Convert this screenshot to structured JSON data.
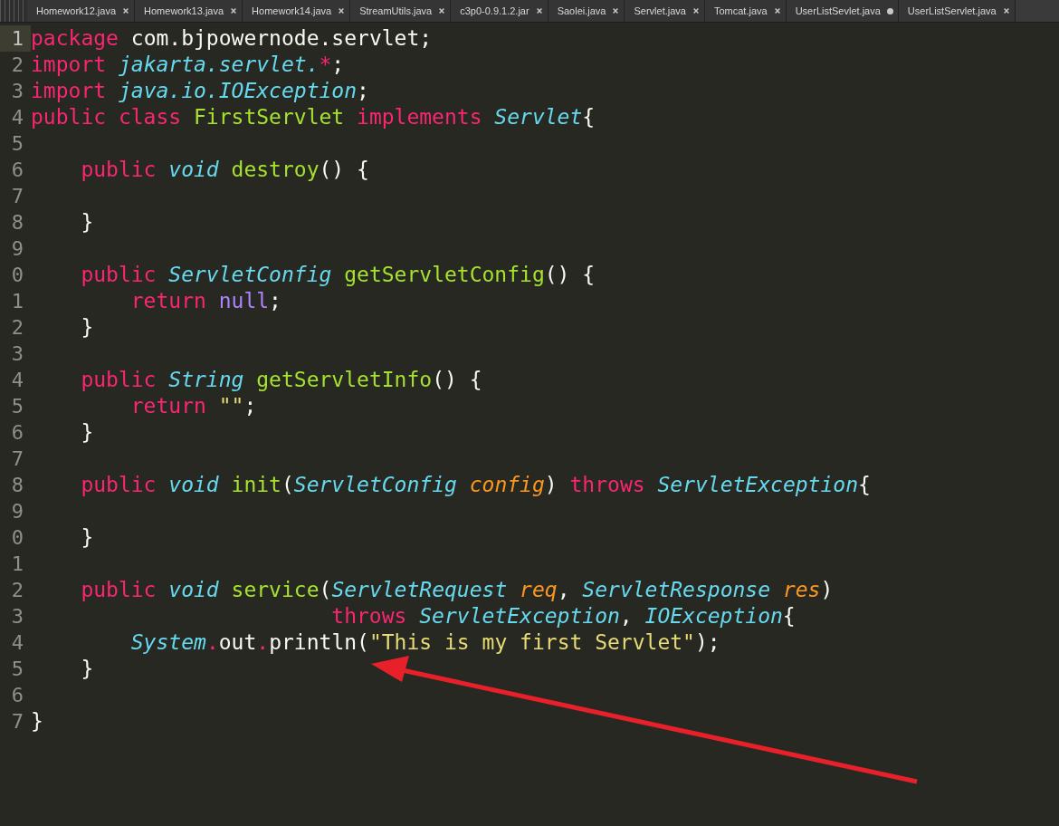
{
  "tabs": [
    {
      "label": "Homework12.java",
      "modified": false
    },
    {
      "label": "Homework13.java",
      "modified": false
    },
    {
      "label": "Homework14.java",
      "modified": false
    },
    {
      "label": "StreamUtils.java",
      "modified": false
    },
    {
      "label": "c3p0-0.9.1.2.jar",
      "modified": false
    },
    {
      "label": "Saolei.java",
      "modified": false
    },
    {
      "label": "Servlet.java",
      "modified": false
    },
    {
      "label": "Tomcat.java",
      "modified": false
    },
    {
      "label": "UserListSevlet.java",
      "modified": true
    },
    {
      "label": "UserListServlet.java",
      "modified": false
    }
  ],
  "editor": {
    "lines": [
      {
        "number": "1",
        "current": true,
        "tokens": [
          {
            "kind": "kw",
            "text": "package "
          },
          {
            "kind": "plain",
            "text": "com.bjpowernode.servlet;"
          }
        ]
      },
      {
        "number": "2",
        "current": false,
        "tokens": [
          {
            "kind": "kw",
            "text": "import "
          },
          {
            "kind": "type",
            "text": "jakarta.servlet."
          },
          {
            "kind": "kw",
            "text": "*"
          },
          {
            "kind": "plain",
            "text": ";"
          }
        ]
      },
      {
        "number": "3",
        "current": false,
        "tokens": [
          {
            "kind": "kw",
            "text": "import "
          },
          {
            "kind": "type",
            "text": "java.io.IOException"
          },
          {
            "kind": "plain",
            "text": ";"
          }
        ]
      },
      {
        "number": "4",
        "current": false,
        "tokens": [
          {
            "kind": "kw",
            "text": "public class "
          },
          {
            "kind": "fn",
            "text": "FirstServlet "
          },
          {
            "kind": "kw",
            "text": "implements "
          },
          {
            "kind": "type",
            "text": "Servlet"
          },
          {
            "kind": "plain",
            "text": "{"
          }
        ]
      },
      {
        "number": "5",
        "current": false
      },
      {
        "number": "6",
        "current": false,
        "tokens": [
          {
            "kind": "kw",
            "text": "    public "
          },
          {
            "kind": "type",
            "text": "void "
          },
          {
            "kind": "fn",
            "text": "destroy"
          },
          {
            "kind": "plain",
            "text": "() {"
          }
        ]
      },
      {
        "number": "7",
        "current": false
      },
      {
        "number": "8",
        "current": false,
        "tokens": [
          {
            "kind": "plain",
            "text": "    }"
          }
        ]
      },
      {
        "number": "9",
        "current": false
      },
      {
        "number": "0",
        "current": false,
        "tokens": [
          {
            "kind": "kw",
            "text": "    public "
          },
          {
            "kind": "type",
            "text": "ServletConfig "
          },
          {
            "kind": "fn",
            "text": "getServletConfig"
          },
          {
            "kind": "plain",
            "text": "() {"
          }
        ]
      },
      {
        "number": "1",
        "current": false,
        "tokens": [
          {
            "kind": "kw",
            "text": "        return "
          },
          {
            "kind": "const",
            "text": "null"
          },
          {
            "kind": "plain",
            "text": ";"
          }
        ]
      },
      {
        "number": "2",
        "current": false,
        "tokens": [
          {
            "kind": "plain",
            "text": "    }"
          }
        ]
      },
      {
        "number": "3",
        "current": false
      },
      {
        "number": "4",
        "current": false,
        "tokens": [
          {
            "kind": "kw",
            "text": "    public "
          },
          {
            "kind": "type",
            "text": "String "
          },
          {
            "kind": "fn",
            "text": "getServletInfo"
          },
          {
            "kind": "plain",
            "text": "() {"
          }
        ]
      },
      {
        "number": "5",
        "current": false,
        "tokens": [
          {
            "kind": "kw",
            "text": "        return "
          },
          {
            "kind": "str",
            "text": "\"\""
          },
          {
            "kind": "plain",
            "text": ";"
          }
        ]
      },
      {
        "number": "6",
        "current": false,
        "tokens": [
          {
            "kind": "plain",
            "text": "    }"
          }
        ]
      },
      {
        "number": "7",
        "current": false
      },
      {
        "number": "8",
        "current": false,
        "tokens": [
          {
            "kind": "kw",
            "text": "    public "
          },
          {
            "kind": "type",
            "text": "void "
          },
          {
            "kind": "fn",
            "text": "init"
          },
          {
            "kind": "plain",
            "text": "("
          },
          {
            "kind": "type",
            "text": "ServletConfig "
          },
          {
            "kind": "param",
            "text": "config"
          },
          {
            "kind": "plain",
            "text": ") "
          },
          {
            "kind": "kw",
            "text": "throws "
          },
          {
            "kind": "type",
            "text": "ServletException"
          },
          {
            "kind": "plain",
            "text": "{"
          }
        ]
      },
      {
        "number": "9",
        "current": false
      },
      {
        "number": "0",
        "current": false,
        "tokens": [
          {
            "kind": "plain",
            "text": "    }"
          }
        ]
      },
      {
        "number": "1",
        "current": false
      },
      {
        "number": "2",
        "current": false,
        "tokens": [
          {
            "kind": "kw",
            "text": "    public "
          },
          {
            "kind": "type",
            "text": "void "
          },
          {
            "kind": "fn",
            "text": "service"
          },
          {
            "kind": "plain",
            "text": "("
          },
          {
            "kind": "type",
            "text": "ServletRequest "
          },
          {
            "kind": "param",
            "text": "req"
          },
          {
            "kind": "plain",
            "text": ", "
          },
          {
            "kind": "type",
            "text": "ServletResponse "
          },
          {
            "kind": "param",
            "text": "res"
          },
          {
            "kind": "plain",
            "text": ")"
          }
        ]
      },
      {
        "number": "3",
        "current": false,
        "tokens": [
          {
            "kind": "kw",
            "text": "                        throws "
          },
          {
            "kind": "type",
            "text": "ServletException"
          },
          {
            "kind": "plain",
            "text": ", "
          },
          {
            "kind": "type",
            "text": "IOException"
          },
          {
            "kind": "plain",
            "text": "{"
          }
        ]
      },
      {
        "number": "4",
        "current": false,
        "tokens": [
          {
            "kind": "type",
            "text": "        System"
          },
          {
            "kind": "kw",
            "text": "."
          },
          {
            "kind": "plain",
            "text": "out"
          },
          {
            "kind": "kw",
            "text": "."
          },
          {
            "kind": "plain",
            "text": "println("
          },
          {
            "kind": "str",
            "text": "\"This is my first Servlet\""
          },
          {
            "kind": "plain",
            "text": ");"
          }
        ]
      },
      {
        "number": "5",
        "current": false,
        "tokens": [
          {
            "kind": "plain",
            "text": "    }"
          }
        ]
      },
      {
        "number": "6",
        "current": false
      },
      {
        "number": "7",
        "current": false,
        "tokens": [
          {
            "kind": "plain",
            "text": "}"
          }
        ]
      }
    ]
  }
}
